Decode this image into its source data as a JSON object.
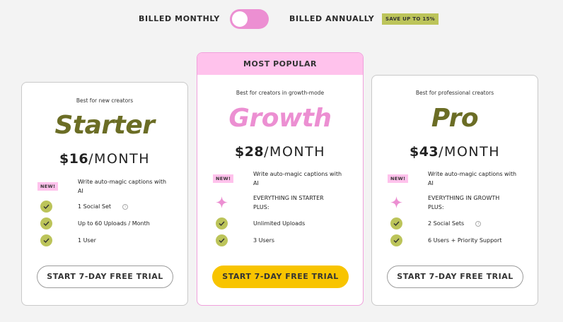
{
  "billing": {
    "monthly_label": "BILLED MONTHLY",
    "annually_label": "BILLED ANNUALLY",
    "save_badge": "SAVE UP TO 15%",
    "toggle_state": "monthly"
  },
  "colors": {
    "starter": "#6b6d25",
    "growth": "#ec8fd2",
    "pro": "#6b6d25",
    "cta_primary": "#f8c400",
    "check": "#bcc45a",
    "badge_pink": "#ffc2ec"
  },
  "plans": [
    {
      "tagline": "Best for new creators",
      "name": "Starter",
      "price": "$16",
      "period": "/MONTH",
      "new_badge": "NEW!",
      "features": [
        {
          "text": "Write auto-magic captions with AI",
          "icon": "new-badge"
        },
        {
          "text": "1 Social Set",
          "icon": "check-icon",
          "info": "i"
        },
        {
          "text": "Up to 60 Uploads / Month",
          "icon": "check-icon"
        },
        {
          "text": "1 User",
          "icon": "check-icon"
        }
      ],
      "cta": "START 7-DAY FREE TRIAL"
    },
    {
      "banner": "MOST POPULAR",
      "tagline": "Best for creators in growth-mode",
      "name": "Growth",
      "price": "$28",
      "period": "/MONTH",
      "new_badge": "NEW!",
      "features": [
        {
          "text": "Write auto-magic captions with AI",
          "icon": "new-badge"
        },
        {
          "text": "EVERYTHING IN STARTER PLUS:",
          "icon": "sparkle-icon"
        },
        {
          "text": "Unlimited Uploads",
          "icon": "check-icon"
        },
        {
          "text": "3 Users",
          "icon": "check-icon"
        }
      ],
      "cta": "START 7-DAY FREE TRIAL"
    },
    {
      "tagline": "Best for professional creators",
      "name": "Pro",
      "price": "$43",
      "period": "/MONTH",
      "new_badge": "NEW!",
      "features": [
        {
          "text": "Write auto-magic captions with AI",
          "icon": "new-badge"
        },
        {
          "text": "EVERYTHING IN GROWTH PLUS:",
          "icon": "sparkle-icon"
        },
        {
          "text": "2 Social Sets",
          "icon": "check-icon",
          "info": "i"
        },
        {
          "text": "6 Users + Priority Support",
          "icon": "check-icon"
        }
      ],
      "cta": "START 7-DAY FREE TRIAL"
    }
  ]
}
